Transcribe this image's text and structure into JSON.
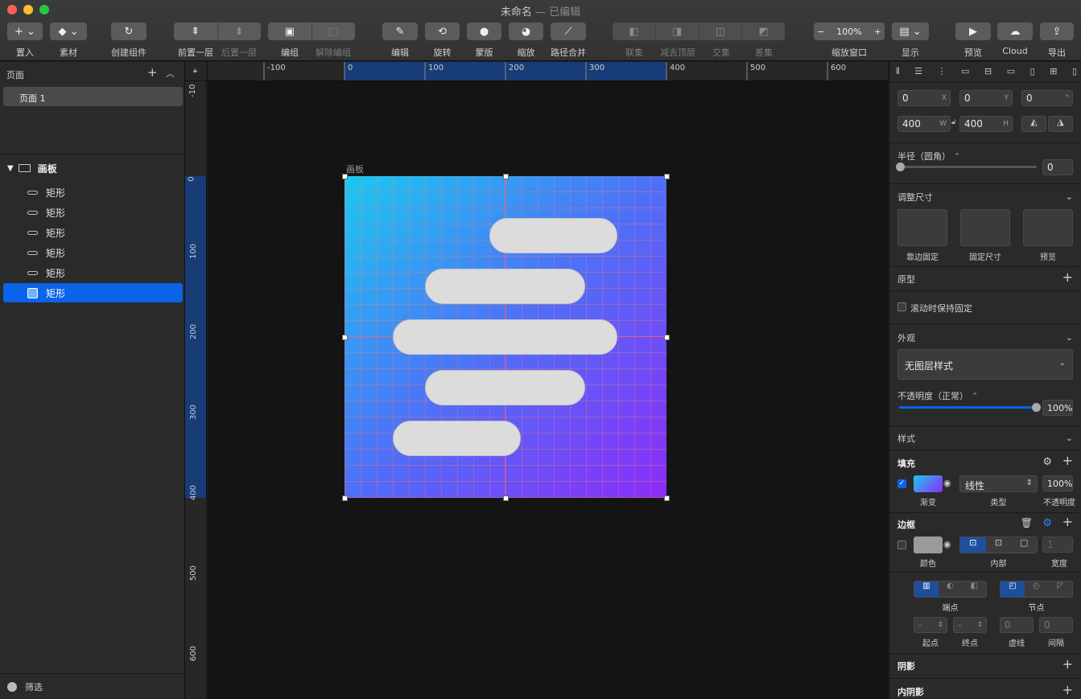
{
  "window": {
    "title": "未命名",
    "subtitle": "— 已编辑"
  },
  "toolbar": {
    "insert": "置入",
    "assets": "素材",
    "create_component": "创建组件",
    "bring_forward": "前置一层",
    "send_backward": "后置一层",
    "group": "编组",
    "ungroup": "解除编组",
    "edit": "编辑",
    "rotate": "旋转",
    "mask": "蒙版",
    "scale": "缩放",
    "flatten": "路径合并",
    "union": "联集",
    "subtract": "减去顶层",
    "intersect": "交集",
    "difference": "差集",
    "zoom_label": "缩放窗口",
    "zoom_value": "100%",
    "zoom_minus": "−",
    "zoom_plus": "+",
    "view": "显示",
    "preview": "预览",
    "cloud": "Cloud",
    "export": "导出"
  },
  "left": {
    "pages_header": "页面",
    "pages": [
      "页面 1"
    ],
    "artboard_name": "画板",
    "layers": [
      "矩形",
      "矩形",
      "矩形",
      "矩形",
      "矩形",
      "矩形"
    ],
    "filter": "筛选"
  },
  "rulers": {
    "h": [
      "-100",
      "0",
      "100",
      "200",
      "300",
      "400",
      "500",
      "600"
    ],
    "v": [
      "-10",
      "0",
      "100",
      "200",
      "300",
      "400",
      "500",
      "600"
    ]
  },
  "canvas": {
    "artboard_label": "画板"
  },
  "inspector": {
    "x": "0",
    "x_unit": "X",
    "y": "0",
    "y_unit": "Y",
    "rot": "0",
    "rot_unit": "°",
    "w": "400",
    "w_unit": "W",
    "h": "400",
    "h_unit": "H",
    "radius_label": "半径（圆角）",
    "radius_value": "0",
    "radius_stepper": "⌃",
    "resize_label": "调整尺寸",
    "resize_opts": [
      "靠边固定",
      "固定尺寸",
      "预览"
    ],
    "prototype": "原型",
    "fix_on_scroll": "滚动时保持固定",
    "appearance": "外观",
    "layer_style": "无图层样式",
    "opacity_label": "不透明度（正常）",
    "opacity_value": "100%",
    "opacity_fraction": 1.0,
    "style": "样式",
    "fill": "填充",
    "fill_type": "线性",
    "fill_opacity": "100%",
    "fill_sub": [
      "渐变",
      "类型",
      "不透明度"
    ],
    "border": "边框",
    "border_width": "1",
    "border_sub": [
      "颜色",
      "内部",
      "宽度"
    ],
    "caps": "端点",
    "joins": "节点",
    "dash_sub": [
      "起点",
      "终点",
      "虚线",
      "间隔"
    ],
    "dash_values": [
      "-",
      "-",
      "0",
      "0"
    ],
    "shadow": "阴影",
    "inner_shadow": "内阴影",
    "accent": "#0a63e8"
  }
}
